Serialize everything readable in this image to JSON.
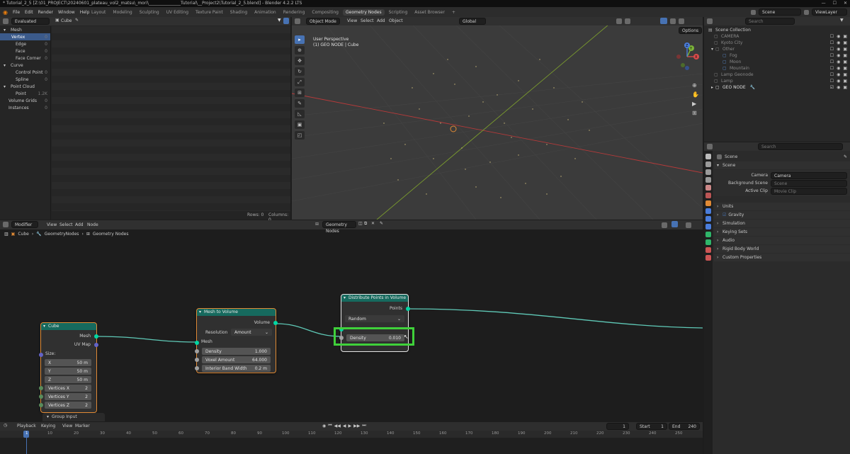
{
  "titlebar": {
    "title": "* Tutorial_2_5 [Z:\\01_PROJECT\\20240601_plateau_vol2_matsu\\_mori\\_______________Tutorial\\__Project2\\Tutorial_2_5.blend] - Blender 4.2.2 LTS"
  },
  "menu": [
    "File",
    "Edit",
    "Render",
    "Window",
    "Help"
  ],
  "workspaces": [
    "Layout",
    "Modeling",
    "Sculpting",
    "UV Editing",
    "Texture Paint",
    "Shading",
    "Animation",
    "Rendering",
    "Compositing",
    "Geometry Nodes",
    "Scripting",
    "Asset Browser"
  ],
  "workspace_active": "Geometry Nodes",
  "topright": {
    "scene": "Scene",
    "view_layer": "ViewLayer"
  },
  "spreadsheet": {
    "display_mode": "Evaluated",
    "object": "Cube",
    "tree": [
      {
        "label": "Mesh",
        "count": "",
        "level": 0
      },
      {
        "label": "Vertex",
        "count": "0",
        "level": 1,
        "selected": true
      },
      {
        "label": "Edge",
        "count": "0",
        "level": 1
      },
      {
        "label": "Face",
        "count": "0",
        "level": 1
      },
      {
        "label": "Face Corner",
        "count": "0",
        "level": 1
      },
      {
        "label": "Curve",
        "count": "",
        "level": 0
      },
      {
        "label": "Control Point",
        "count": "0",
        "level": 1
      },
      {
        "label": "Spline",
        "count": "0",
        "level": 1
      },
      {
        "label": "Point Cloud",
        "count": "",
        "level": 0
      },
      {
        "label": "Point",
        "count": "1.2K",
        "level": 1
      },
      {
        "label": "Volume Grids",
        "count": "0",
        "level": 0
      },
      {
        "label": "Instances",
        "count": "0",
        "level": 0
      }
    ],
    "footer": {
      "rows": "Rows: 0",
      "columns": "Columns: 0"
    }
  },
  "viewport": {
    "mode": "Object Mode",
    "menus": [
      "View",
      "Select",
      "Add",
      "Object"
    ],
    "transform": "Global",
    "info_line1": "User Perspective",
    "info_line2": "(1) GEO NODE | Cube",
    "options": "Options",
    "gizmo": {
      "x": "X",
      "y": "Y",
      "z": "Z"
    }
  },
  "outliner": {
    "search_placeholder": "Search",
    "items": [
      {
        "label": "Scene Collection",
        "level": 0
      },
      {
        "label": "CAMERA",
        "level": 1
      },
      {
        "label": "Kyoto City",
        "level": 1
      },
      {
        "label": "Other",
        "level": 1
      },
      {
        "label": "Fog",
        "level": 2
      },
      {
        "label": "Moon",
        "level": 2
      },
      {
        "label": "Mountain",
        "level": 2
      },
      {
        "label": "Lamp Geonode",
        "level": 1
      },
      {
        "label": "Lamp",
        "level": 1
      },
      {
        "label": "GEO NODE",
        "level": 1
      }
    ]
  },
  "properties": {
    "search_placeholder": "Search",
    "context": "Scene",
    "section": "Scene",
    "fields": [
      {
        "label": "Camera",
        "value": "Camera"
      },
      {
        "label": "Background Scene",
        "value": "Scene"
      },
      {
        "label": "Active Clip",
        "value": "Movie Clip"
      }
    ],
    "panels": [
      "Units",
      "Gravity",
      "Simulation",
      "Keying Sets",
      "Audio",
      "Rigid Body World",
      "Custom Properties"
    ]
  },
  "node_editor": {
    "editor_type": "Modifier",
    "menus": [
      "View",
      "Select",
      "Add",
      "Node"
    ],
    "tree_name": "Geometry Nodes",
    "breadcrumb": [
      "Cube",
      "GeometryNodes",
      "Geometry Nodes"
    ],
    "cube_node": {
      "title": "Cube",
      "outputs": [
        "Mesh",
        "UV Map"
      ],
      "size_label": "Size:",
      "size": [
        {
          "axis": "X",
          "value": "50 m"
        },
        {
          "axis": "Y",
          "value": "50 m"
        },
        {
          "axis": "Z",
          "value": "50 m"
        }
      ],
      "vertices": [
        {
          "label": "Vertices X",
          "value": "2"
        },
        {
          "label": "Vertices Y",
          "value": "2"
        },
        {
          "label": "Vertices Z",
          "value": "2"
        }
      ]
    },
    "group_input": "Group Input",
    "mesh_to_volume": {
      "title": "Mesh to Volume",
      "output": "Volume",
      "resolution_label": "Resolution",
      "resolution_value": "Amount",
      "input": "Mesh",
      "fields": [
        {
          "label": "Density",
          "value": "1.000"
        },
        {
          "label": "Voxel Amount",
          "value": "64.000"
        },
        {
          "label": "Interior Band Width",
          "value": "0.2 m"
        }
      ]
    },
    "distribute": {
      "title": "Distribute Points in Volume",
      "output": "Points",
      "mode": "Random",
      "density_label": "Density",
      "density_value": "0.010"
    }
  },
  "timeline": {
    "menus": [
      "Playback",
      "Keying",
      "View",
      "Marker"
    ],
    "current_frame": "1",
    "start_label": "Start",
    "start": "1",
    "end_label": "End",
    "end": "240",
    "ticks": [
      "1",
      "10",
      "20",
      "30",
      "40",
      "50",
      "60",
      "70",
      "80",
      "90",
      "100",
      "110",
      "120",
      "130",
      "140",
      "150",
      "160",
      "170",
      "180",
      "190",
      "200",
      "210",
      "220",
      "230",
      "240",
      "250"
    ]
  },
  "colors": {
    "accent": "#4772b3",
    "node_header": "#166a5e",
    "highlight_box": "#3fd13a",
    "wire": "#5fc9b7"
  }
}
